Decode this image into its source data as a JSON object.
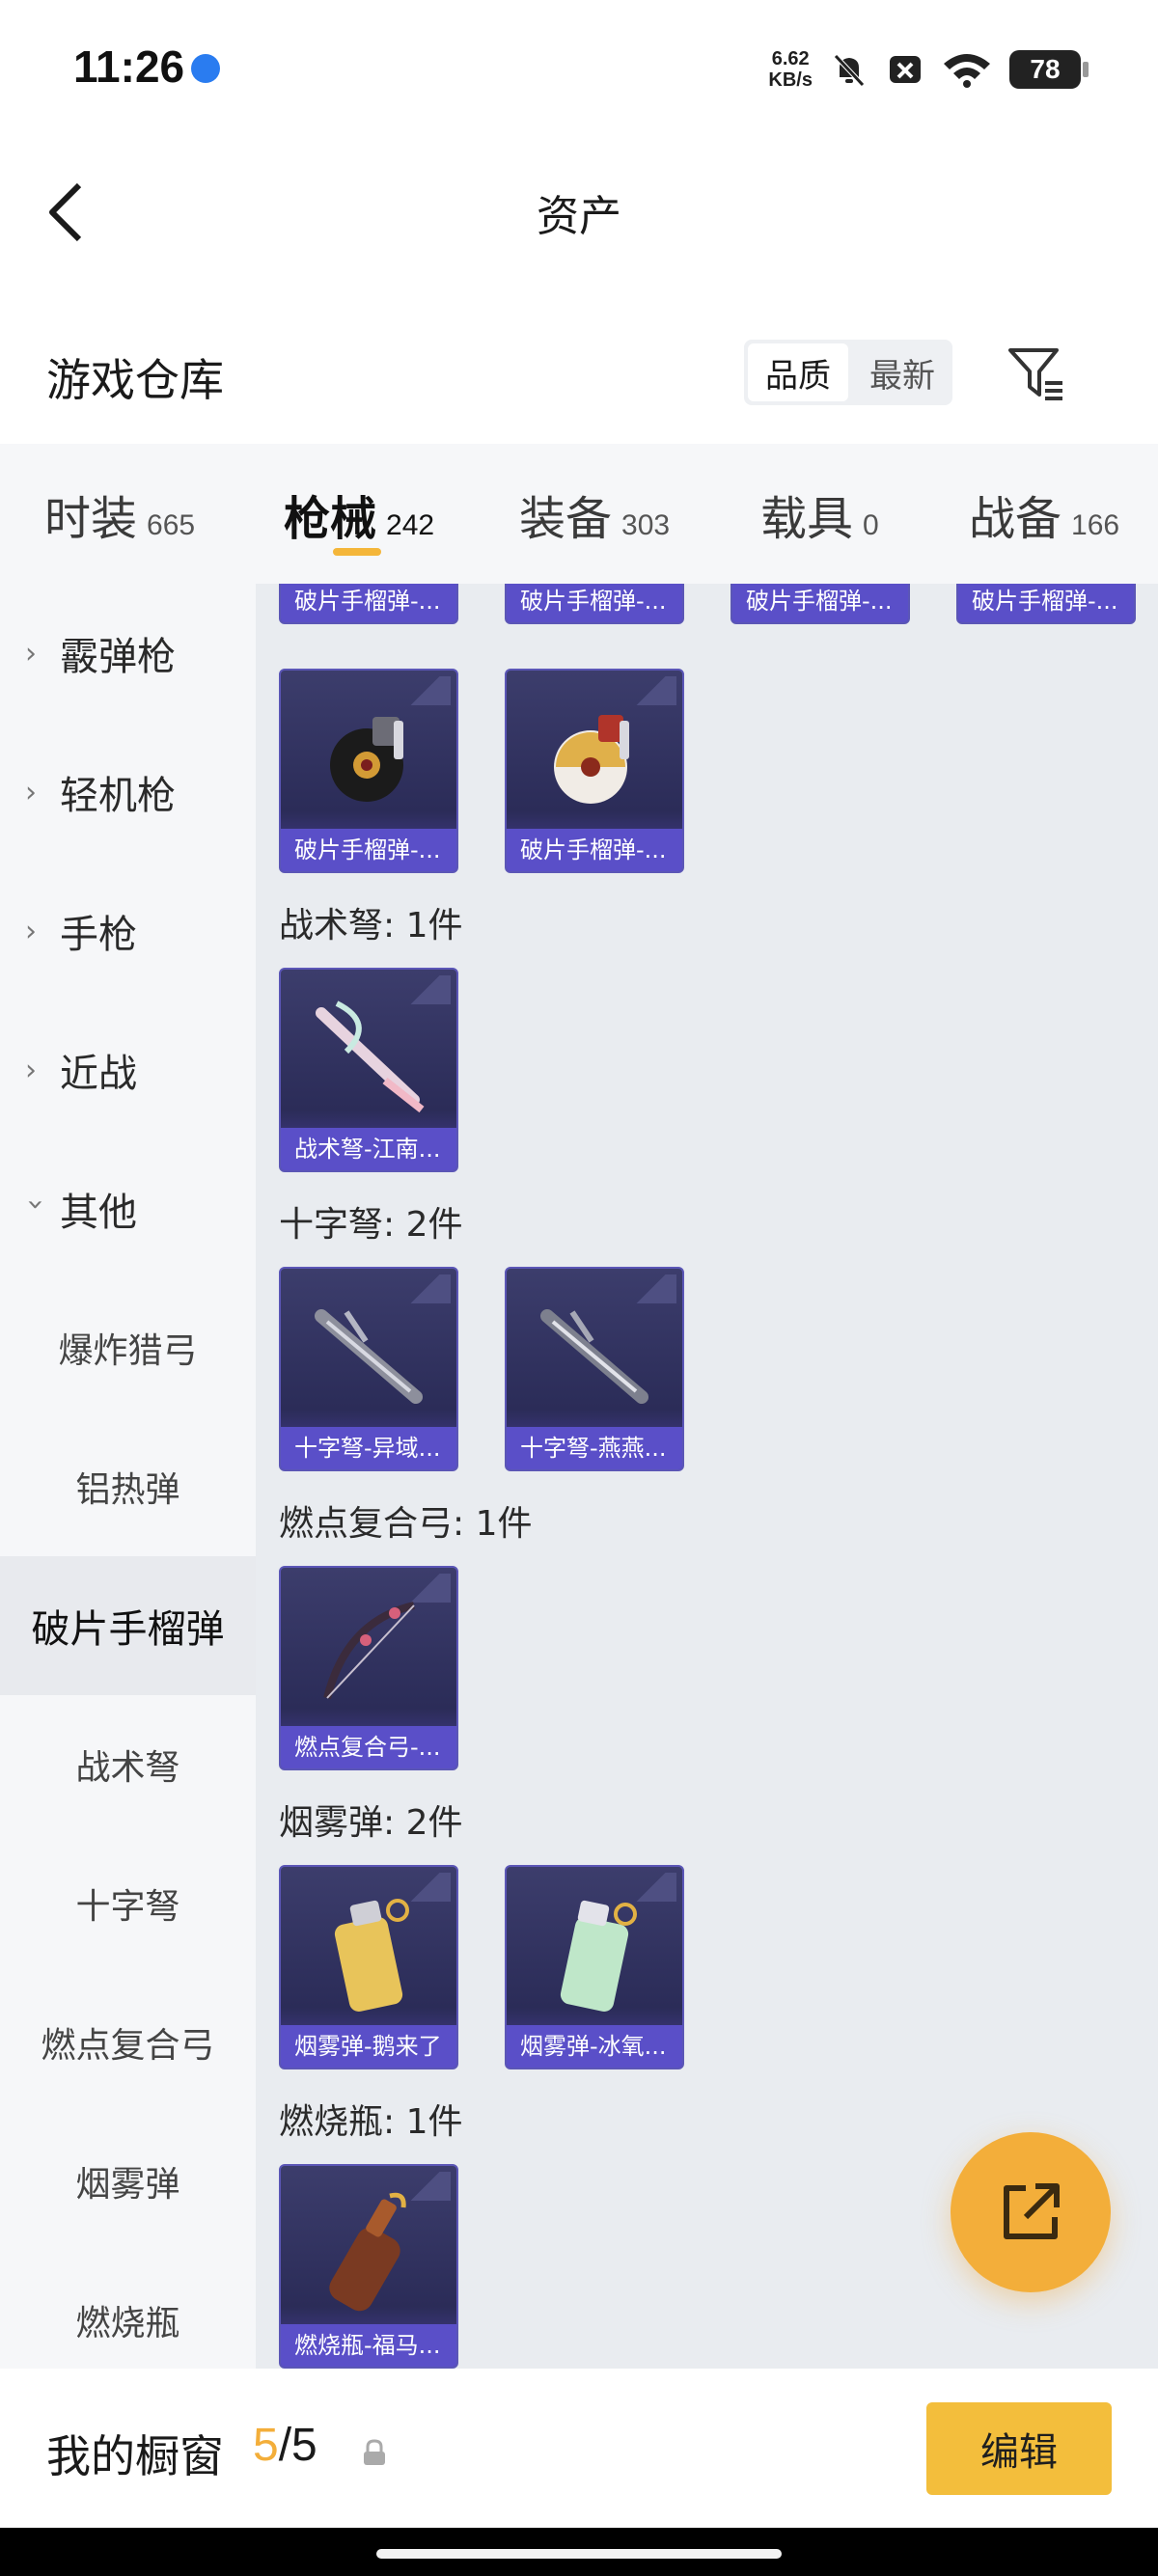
{
  "status": {
    "time": "11:26",
    "net_speed": "6.62",
    "net_unit": "KB/s",
    "battery": "78"
  },
  "header": {
    "title": "资产"
  },
  "section": {
    "title": "游戏仓库",
    "sort_options": [
      "品质",
      "最新"
    ]
  },
  "tabs": [
    {
      "label": "时装",
      "count": "665"
    },
    {
      "label": "枪械",
      "count": "242"
    },
    {
      "label": "装备",
      "count": "303"
    },
    {
      "label": "载具",
      "count": "0"
    },
    {
      "label": "战备",
      "count": "166"
    }
  ],
  "sidebar": {
    "groups": [
      "霰弹枪",
      "轻机枪",
      "手枪",
      "近战",
      "其他"
    ],
    "subs": [
      "爆炸猎弓",
      "铝热弹",
      "破片手榴弹",
      "战术弩",
      "十字弩",
      "燃点复合弓",
      "烟雾弹",
      "燃烧瓶"
    ]
  },
  "grid": {
    "top_row": [
      "破片手榴弹-...",
      "破片手榴弹-...",
      "破片手榴弹-...",
      "破片手榴弹-..."
    ],
    "grenade_row": [
      "破片手榴弹-...",
      "破片手榴弹-..."
    ],
    "groups": [
      {
        "heading": "战术弩: 1件",
        "items": [
          "战术弩-江南..."
        ]
      },
      {
        "heading": "十字弩: 2件",
        "items": [
          "十字弩-异域...",
          "十字弩-燕燕..."
        ]
      },
      {
        "heading": "燃点复合弓: 1件",
        "items": [
          "燃点复合弓-..."
        ]
      },
      {
        "heading": "烟雾弹: 2件",
        "items": [
          "烟雾弹-鹅来了",
          "烟雾弹-冰氧..."
        ]
      },
      {
        "heading": "燃烧瓶: 1件",
        "items": [
          "燃烧瓶-福马..."
        ]
      }
    ]
  },
  "bottom": {
    "label": "我的橱窗",
    "current": "5",
    "separator": "/",
    "total": "5",
    "edit_label": "编辑"
  },
  "colors": {
    "accent": "#f3ae3a",
    "card_label": "#5a4fc8",
    "card_bg": "#2b2c58"
  }
}
